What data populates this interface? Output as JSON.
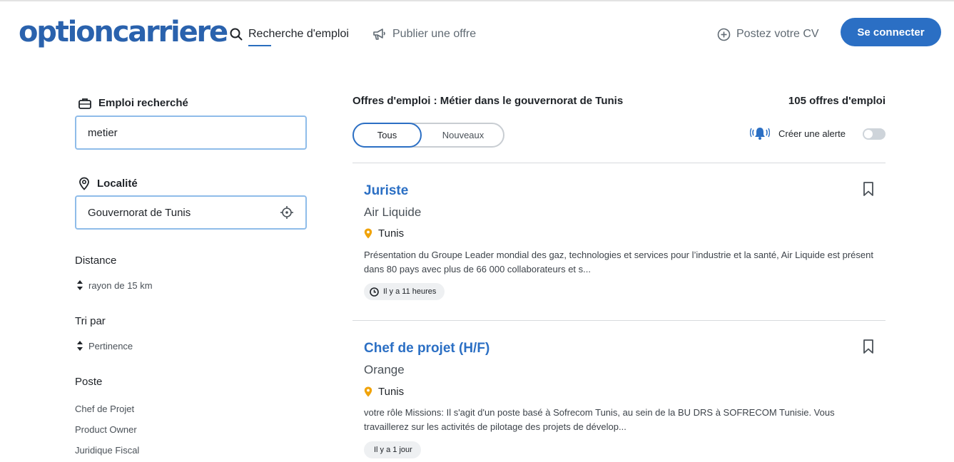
{
  "header": {
    "logo": "optioncarriere",
    "nav": {
      "search_label": "Recherche d'emploi",
      "publish_label": "Publier une offre",
      "cv_label": "Postez votre CV"
    },
    "login_label": "Se connecter"
  },
  "sidebar": {
    "job_label": "Emploi recherché",
    "job_value": "metier",
    "location_label": "Localité",
    "location_value": "Gouvernorat de Tunis",
    "distance_title": "Distance",
    "distance_value": "rayon de 15 km",
    "sort_title": "Tri par",
    "sort_value": "Pertinence",
    "poste_title": "Poste",
    "poste_items": [
      "Chef de Projet",
      "Product Owner",
      "Juridique Fiscal"
    ]
  },
  "results": {
    "title": "Offres d'emploi : Métier dans le gouvernorat de Tunis",
    "count": "105 offres d'emploi",
    "tabs": [
      "Tous",
      "Nouveaux"
    ],
    "alert_label": "Créer une alerte",
    "alert_enabled": false
  },
  "jobs": [
    {
      "title": "Juriste",
      "company": "Air Liquide",
      "location": "Tunis",
      "description": "Présentation du Groupe Leader mondial des gaz, technologies et services pour l’industrie et la santé, Air Liquide est présent dans 80 pays avec plus de 66 000 collaborateurs et s...",
      "posted": "Il y a 11 heures"
    },
    {
      "title": "Chef de projet (H/F)",
      "company": "Orange",
      "location": "Tunis",
      "description": "votre rôle Missions: Il s'agit d'un poste basé à Sofrecom Tunis, au sein de la BU DRS à SOFRECOM Tunisie. Vous travaillerez sur les activités de pilotage des projets de dévelop...",
      "posted": "Il y a 1 jour"
    }
  ],
  "colors": {
    "brand": "#2a62ad",
    "primary_button": "#2b6fc4",
    "link": "#2b6fc4",
    "location_pin": "#f0a30a",
    "input_border": "#8fbce9"
  }
}
